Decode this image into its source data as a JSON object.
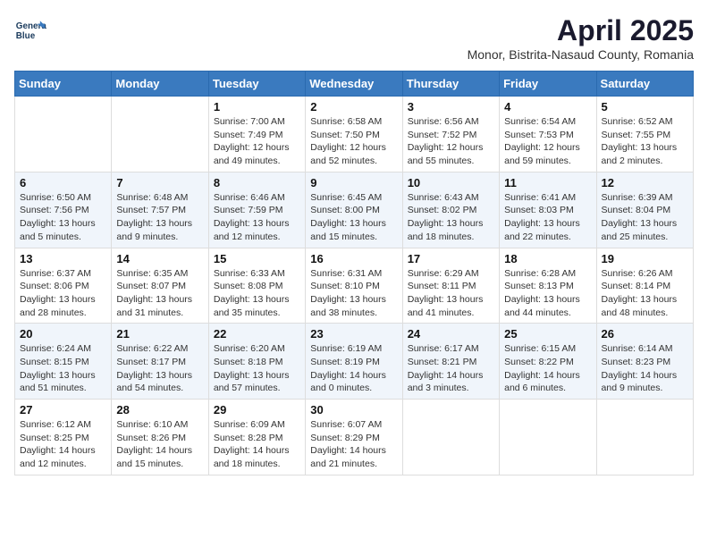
{
  "header": {
    "logo_line1": "General",
    "logo_line2": "Blue",
    "month_title": "April 2025",
    "location": "Monor, Bistrita-Nasaud County, Romania"
  },
  "weekdays": [
    "Sunday",
    "Monday",
    "Tuesday",
    "Wednesday",
    "Thursday",
    "Friday",
    "Saturday"
  ],
  "weeks": [
    [
      {
        "day": null
      },
      {
        "day": null
      },
      {
        "day": "1",
        "sunrise": "Sunrise: 7:00 AM",
        "sunset": "Sunset: 7:49 PM",
        "daylight": "Daylight: 12 hours and 49 minutes."
      },
      {
        "day": "2",
        "sunrise": "Sunrise: 6:58 AM",
        "sunset": "Sunset: 7:50 PM",
        "daylight": "Daylight: 12 hours and 52 minutes."
      },
      {
        "day": "3",
        "sunrise": "Sunrise: 6:56 AM",
        "sunset": "Sunset: 7:52 PM",
        "daylight": "Daylight: 12 hours and 55 minutes."
      },
      {
        "day": "4",
        "sunrise": "Sunrise: 6:54 AM",
        "sunset": "Sunset: 7:53 PM",
        "daylight": "Daylight: 12 hours and 59 minutes."
      },
      {
        "day": "5",
        "sunrise": "Sunrise: 6:52 AM",
        "sunset": "Sunset: 7:55 PM",
        "daylight": "Daylight: 13 hours and 2 minutes."
      }
    ],
    [
      {
        "day": "6",
        "sunrise": "Sunrise: 6:50 AM",
        "sunset": "Sunset: 7:56 PM",
        "daylight": "Daylight: 13 hours and 5 minutes."
      },
      {
        "day": "7",
        "sunrise": "Sunrise: 6:48 AM",
        "sunset": "Sunset: 7:57 PM",
        "daylight": "Daylight: 13 hours and 9 minutes."
      },
      {
        "day": "8",
        "sunrise": "Sunrise: 6:46 AM",
        "sunset": "Sunset: 7:59 PM",
        "daylight": "Daylight: 13 hours and 12 minutes."
      },
      {
        "day": "9",
        "sunrise": "Sunrise: 6:45 AM",
        "sunset": "Sunset: 8:00 PM",
        "daylight": "Daylight: 13 hours and 15 minutes."
      },
      {
        "day": "10",
        "sunrise": "Sunrise: 6:43 AM",
        "sunset": "Sunset: 8:02 PM",
        "daylight": "Daylight: 13 hours and 18 minutes."
      },
      {
        "day": "11",
        "sunrise": "Sunrise: 6:41 AM",
        "sunset": "Sunset: 8:03 PM",
        "daylight": "Daylight: 13 hours and 22 minutes."
      },
      {
        "day": "12",
        "sunrise": "Sunrise: 6:39 AM",
        "sunset": "Sunset: 8:04 PM",
        "daylight": "Daylight: 13 hours and 25 minutes."
      }
    ],
    [
      {
        "day": "13",
        "sunrise": "Sunrise: 6:37 AM",
        "sunset": "Sunset: 8:06 PM",
        "daylight": "Daylight: 13 hours and 28 minutes."
      },
      {
        "day": "14",
        "sunrise": "Sunrise: 6:35 AM",
        "sunset": "Sunset: 8:07 PM",
        "daylight": "Daylight: 13 hours and 31 minutes."
      },
      {
        "day": "15",
        "sunrise": "Sunrise: 6:33 AM",
        "sunset": "Sunset: 8:08 PM",
        "daylight": "Daylight: 13 hours and 35 minutes."
      },
      {
        "day": "16",
        "sunrise": "Sunrise: 6:31 AM",
        "sunset": "Sunset: 8:10 PM",
        "daylight": "Daylight: 13 hours and 38 minutes."
      },
      {
        "day": "17",
        "sunrise": "Sunrise: 6:29 AM",
        "sunset": "Sunset: 8:11 PM",
        "daylight": "Daylight: 13 hours and 41 minutes."
      },
      {
        "day": "18",
        "sunrise": "Sunrise: 6:28 AM",
        "sunset": "Sunset: 8:13 PM",
        "daylight": "Daylight: 13 hours and 44 minutes."
      },
      {
        "day": "19",
        "sunrise": "Sunrise: 6:26 AM",
        "sunset": "Sunset: 8:14 PM",
        "daylight": "Daylight: 13 hours and 48 minutes."
      }
    ],
    [
      {
        "day": "20",
        "sunrise": "Sunrise: 6:24 AM",
        "sunset": "Sunset: 8:15 PM",
        "daylight": "Daylight: 13 hours and 51 minutes."
      },
      {
        "day": "21",
        "sunrise": "Sunrise: 6:22 AM",
        "sunset": "Sunset: 8:17 PM",
        "daylight": "Daylight: 13 hours and 54 minutes."
      },
      {
        "day": "22",
        "sunrise": "Sunrise: 6:20 AM",
        "sunset": "Sunset: 8:18 PM",
        "daylight": "Daylight: 13 hours and 57 minutes."
      },
      {
        "day": "23",
        "sunrise": "Sunrise: 6:19 AM",
        "sunset": "Sunset: 8:19 PM",
        "daylight": "Daylight: 14 hours and 0 minutes."
      },
      {
        "day": "24",
        "sunrise": "Sunrise: 6:17 AM",
        "sunset": "Sunset: 8:21 PM",
        "daylight": "Daylight: 14 hours and 3 minutes."
      },
      {
        "day": "25",
        "sunrise": "Sunrise: 6:15 AM",
        "sunset": "Sunset: 8:22 PM",
        "daylight": "Daylight: 14 hours and 6 minutes."
      },
      {
        "day": "26",
        "sunrise": "Sunrise: 6:14 AM",
        "sunset": "Sunset: 8:23 PM",
        "daylight": "Daylight: 14 hours and 9 minutes."
      }
    ],
    [
      {
        "day": "27",
        "sunrise": "Sunrise: 6:12 AM",
        "sunset": "Sunset: 8:25 PM",
        "daylight": "Daylight: 14 hours and 12 minutes."
      },
      {
        "day": "28",
        "sunrise": "Sunrise: 6:10 AM",
        "sunset": "Sunset: 8:26 PM",
        "daylight": "Daylight: 14 hours and 15 minutes."
      },
      {
        "day": "29",
        "sunrise": "Sunrise: 6:09 AM",
        "sunset": "Sunset: 8:28 PM",
        "daylight": "Daylight: 14 hours and 18 minutes."
      },
      {
        "day": "30",
        "sunrise": "Sunrise: 6:07 AM",
        "sunset": "Sunset: 8:29 PM",
        "daylight": "Daylight: 14 hours and 21 minutes."
      },
      {
        "day": null
      },
      {
        "day": null
      },
      {
        "day": null
      }
    ]
  ]
}
